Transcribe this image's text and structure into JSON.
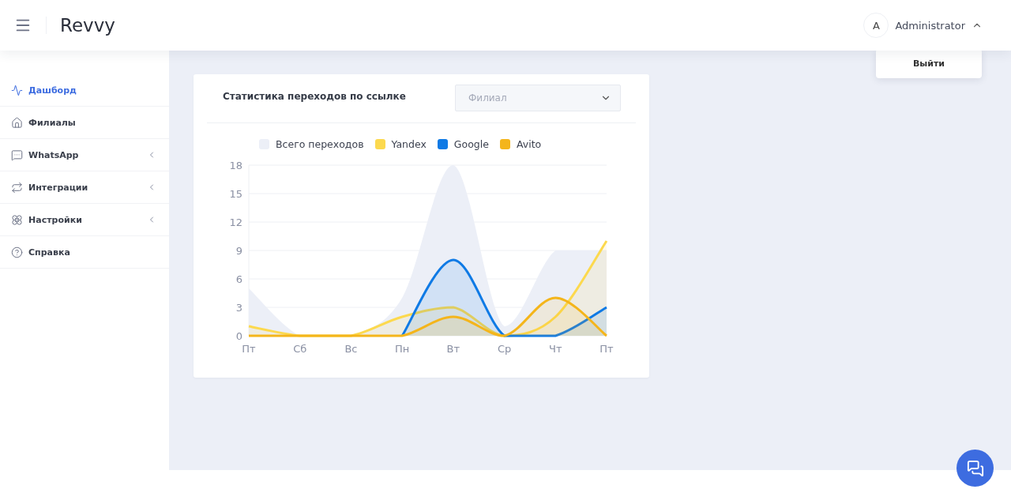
{
  "header": {
    "logo": "Revvy",
    "user": {
      "initial": "A",
      "name": "Administrator",
      "menu_open": true
    },
    "user_menu": [
      "Выйти"
    ]
  },
  "sidebar": {
    "items": [
      {
        "label": "Дашборд",
        "selected": true,
        "has_submenu": false
      },
      {
        "label": "Филиалы",
        "selected": false,
        "has_submenu": false
      },
      {
        "label": "WhatsApp",
        "selected": false,
        "has_submenu": true
      },
      {
        "label": "Интеграции",
        "selected": false,
        "has_submenu": true
      },
      {
        "label": "Настройки",
        "selected": false,
        "has_submenu": true
      },
      {
        "label": "Справка",
        "selected": false,
        "has_submenu": false
      }
    ]
  },
  "card": {
    "title": "Статистика переходов по ссылке",
    "filter": {
      "placeholder": "Филиал"
    },
    "chart_data": {
      "type": "line",
      "categories": [
        "Пт",
        "Сб",
        "Вс",
        "Пн",
        "Вт",
        "Ср",
        "Чт",
        "Пт"
      ],
      "ylim": [
        0,
        18
      ],
      "yticks": [
        0,
        3,
        6,
        9,
        12,
        15,
        18
      ],
      "grid": true,
      "series": [
        {
          "name": "Всего переходов",
          "type": "area",
          "color": "#eceff7",
          "values": [
            5,
            0,
            0,
            4,
            18,
            1,
            9,
            9
          ]
        },
        {
          "name": "Yandex",
          "type": "line",
          "color": "#fcd94e",
          "values": [
            1,
            0,
            0,
            2,
            3,
            0,
            2,
            10
          ]
        },
        {
          "name": "Google",
          "type": "line",
          "color": "#0f7ae5",
          "values": [
            null,
            null,
            null,
            0,
            8,
            0,
            0,
            3
          ]
        },
        {
          "name": "Avito",
          "type": "line",
          "color": "#f4b51b",
          "values": [
            0,
            0,
            0,
            0,
            2,
            0,
            4,
            0
          ]
        }
      ]
    }
  }
}
